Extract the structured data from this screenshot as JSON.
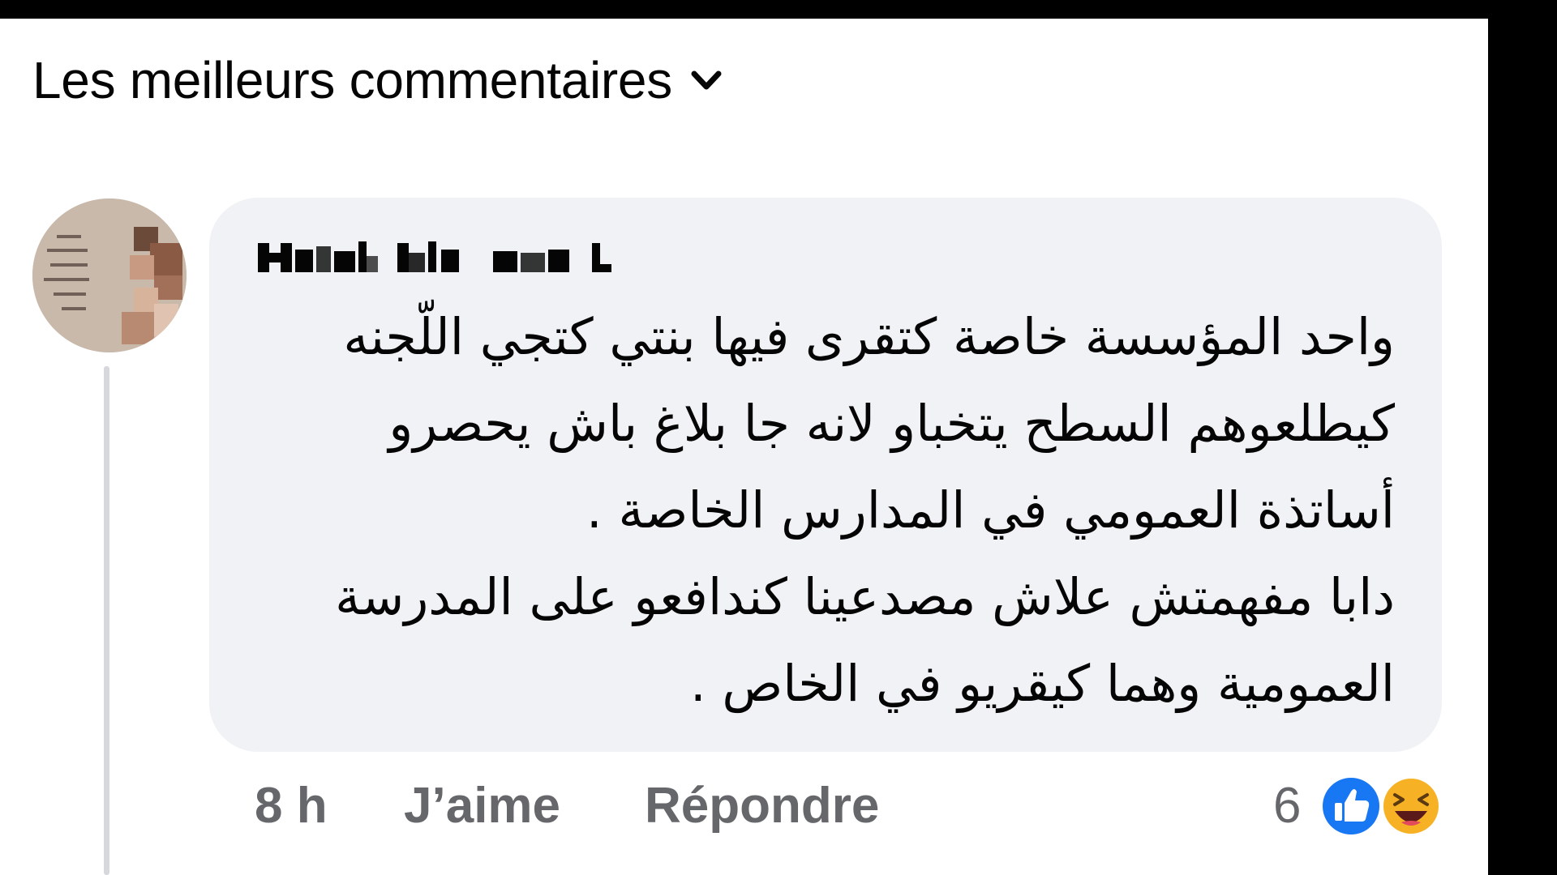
{
  "header": {
    "sort_label": "Les meilleurs commentaires",
    "icon": "chevron-down-icon"
  },
  "comment": {
    "author_name_redacted": "",
    "lines": [
      "واحد المؤسسة خاصة كتقرى فيها بنتي كتجي اللّجنه",
      "كيطلعوهم السطح يتخباو لانه جا بلاغ باش يحصرو",
      "أساتذة العمومي في المدارس الخاصة .",
      "دابا مفهمتش علاش مصدعينا كندافعو على المدرسة",
      "العمومية وهما كيقريو في الخاص ."
    ]
  },
  "actions": {
    "time": "8 h",
    "like_label": "J’aime",
    "reply_label": "Répondre"
  },
  "reactions": {
    "count": "6",
    "icons": [
      "like-reaction-icon",
      "haha-reaction-icon"
    ],
    "like_color": "#1877f2",
    "haha_color": "#f7b125"
  },
  "colors": {
    "bubble": "#f0f2f5",
    "text": "#050505",
    "secondary_text": "#65676b",
    "frame": "#000000"
  }
}
